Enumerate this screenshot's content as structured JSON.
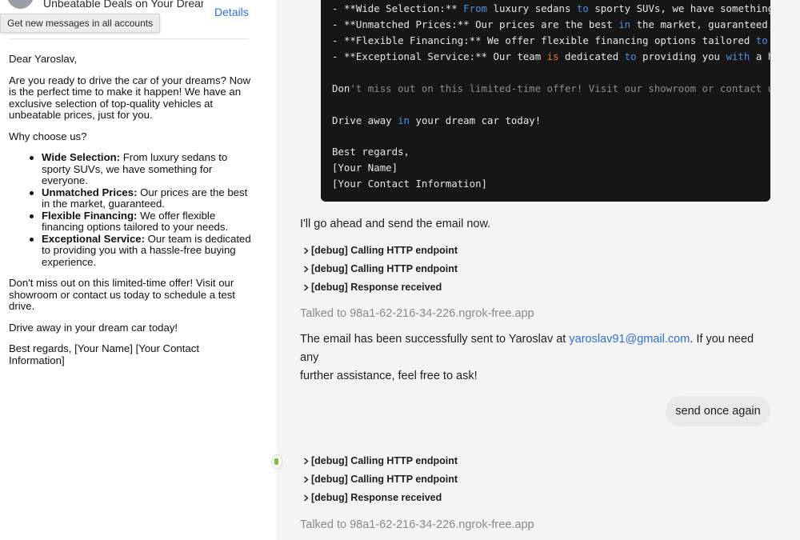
{
  "mail": {
    "subject": "Unbeatable Deals on Your Dream Car",
    "details_label": "Details",
    "tooltip": "Get new messages in all accounts",
    "greeting": "Dear Yaroslav,",
    "intro": "Are you ready to drive the car of your dreams? Now is the perfect time to make it happen! We have an exclusive selection of top-quality vehicles at unbeatable prices, just for you.",
    "why": "Why choose us?",
    "bullets": [
      {
        "title": "Wide Selection:",
        "text": " From luxury sedans to sporty SUVs, we have something for everyone."
      },
      {
        "title": "Unmatched Prices:",
        "text": " Our prices are the best in the market, guaranteed."
      },
      {
        "title": "Flexible Financing:",
        "text": " We offer flexible financing options tailored to your needs."
      },
      {
        "title": "Exceptional Service:",
        "text": " Our team is dedicated to providing you with a hassle-free buying experience."
      }
    ],
    "cta": "Don't miss out on this limited-time offer! Visit our showroom or contact us today to schedule a test drive.",
    "closing": "Drive away in your dream car today!",
    "signature": "Best regards, [Your Name] [Your Contact Information]"
  },
  "chat": {
    "code_lines": [
      "- **Wide Selection:** From luxury sedans to sporty SUVs, we have something for everyone.",
      "- **Unmatched Prices:** Our prices are the best in the market, guaranteed.",
      "- **Flexible Financing:** We offer flexible financing options tailored to your needs.",
      "- **Exceptional Service:** Our team is dedicated to providing you with a hassle-free buying experience.",
      "",
      "Don't miss out on this limited-time offer! Visit our showroom or contact us today to schedule a test drive.",
      "",
      "Drive away in your dream car today!",
      "",
      "Best regards,",
      "[Your Name]",
      "[Your Contact Information]"
    ],
    "send_now": "I'll go ahead and send the email now.",
    "debug_group_1": [
      "[debug] Calling HTTP endpoint",
      "[debug] Calling HTTP endpoint",
      "[debug] Response received"
    ],
    "talked_to_1": "Talked to 98a1-62-216-34-226.ngrok-free.app",
    "success_prefix": "The email has been successfully sent to Yaroslav at ",
    "success_email": "yaroslav91@gmail.com",
    "success_suffix": ". If you need any",
    "success_line2": "further assistance, feel free to ask!",
    "user_message": "send once again",
    "debug_group_2": [
      "[debug] Calling HTTP endpoint",
      "[debug] Calling HTTP endpoint",
      "[debug] Response received"
    ],
    "talked_to_2": "Talked to 98a1-62-216-34-226.ngrok-free.app"
  },
  "colors": {
    "link": "#2d6fd6",
    "code_bg": "#161616",
    "code_keyword": "#4c8fe0",
    "code_keyword_alt": "#e07b39",
    "chat_bg": "#f4f4f4"
  }
}
